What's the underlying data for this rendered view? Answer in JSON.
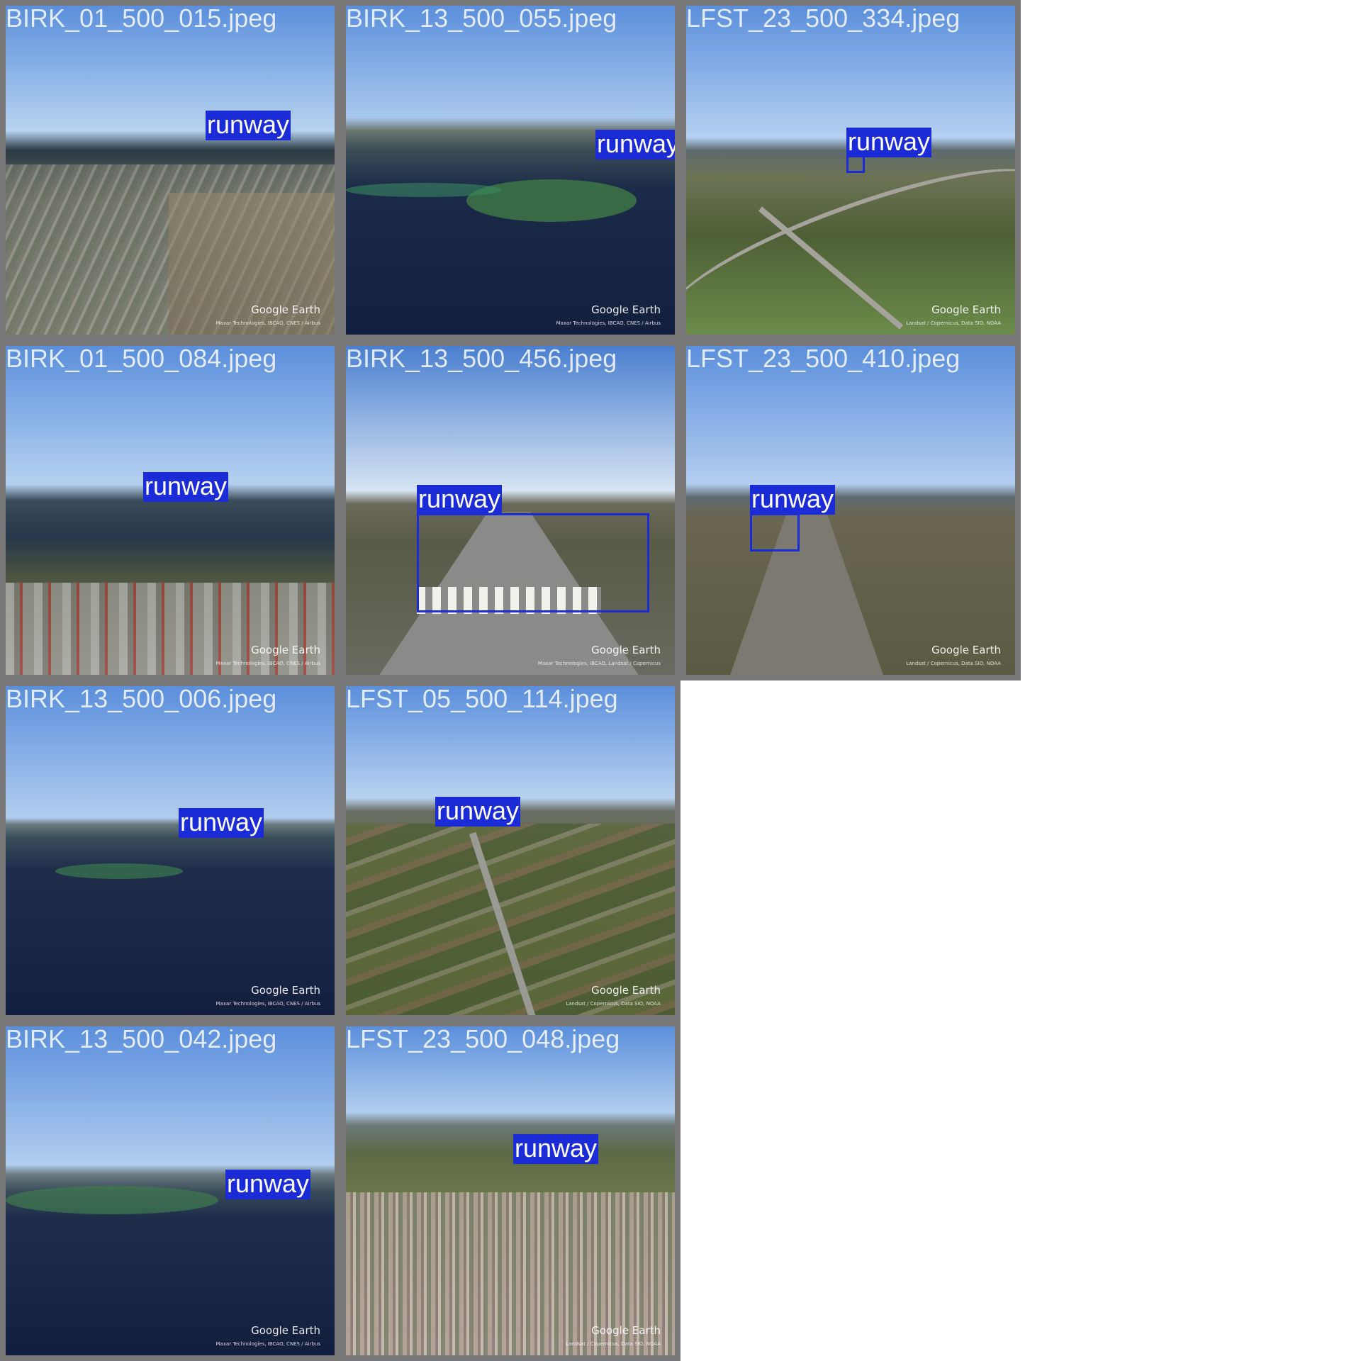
{
  "tiles": [
    {
      "filename": "BIRK_01_500_015.jpeg",
      "label": "runway",
      "scene": "city",
      "credit": "Maxar Technologies, IBCAO, CNES / Airbus"
    },
    {
      "filename": "BIRK_13_500_055.jpeg",
      "label": "runway",
      "scene": "bay",
      "credit": "Maxar Technologies, IBCAO, CNES / Airbus"
    },
    {
      "filename": "LFST_23_500_334.jpeg",
      "label": "runway",
      "scene": "highway",
      "credit": "Landsat / Copernicus, Data SIO, NOAA"
    },
    {
      "filename": "BIRK_01_500_084.jpeg",
      "label": "runway",
      "scene": "industrial",
      "credit": "Maxar Technologies, IBCAO, CNES / Airbus"
    },
    {
      "filename": "BIRK_13_500_456.jpeg",
      "label": "runway",
      "scene": "threshold",
      "credit": "Maxar Technologies, IBCAO, Landsat / Copernicus"
    },
    {
      "filename": "LFST_23_500_410.jpeg",
      "label": "runway",
      "scene": "approach",
      "credit": "Landsat / Copernicus, Data SIO, NOAA"
    },
    {
      "filename": "BIRK_13_500_006.jpeg",
      "label": "runway",
      "scene": "sea",
      "credit": "Maxar Technologies, IBCAO, CNES / Airbus"
    },
    {
      "filename": "LFST_05_500_114.jpeg",
      "label": "runway",
      "scene": "fields",
      "credit": "Landsat / Copernicus, Data SIO, NOAA"
    },
    {
      "filename": "BIRK_13_500_042.jpeg",
      "label": "runway",
      "scene": "bay",
      "credit": "Maxar Technologies, IBCAO, CNES / Airbus"
    },
    {
      "filename": "LFST_23_500_048.jpeg",
      "label": "runway",
      "scene": "town",
      "credit": "Landsat / Copernicus, Data SIO, NOAA"
    }
  ],
  "watermark": "Google Earth",
  "colors": {
    "label_bg": "#1b2cd6",
    "tile_border": "#777777"
  }
}
